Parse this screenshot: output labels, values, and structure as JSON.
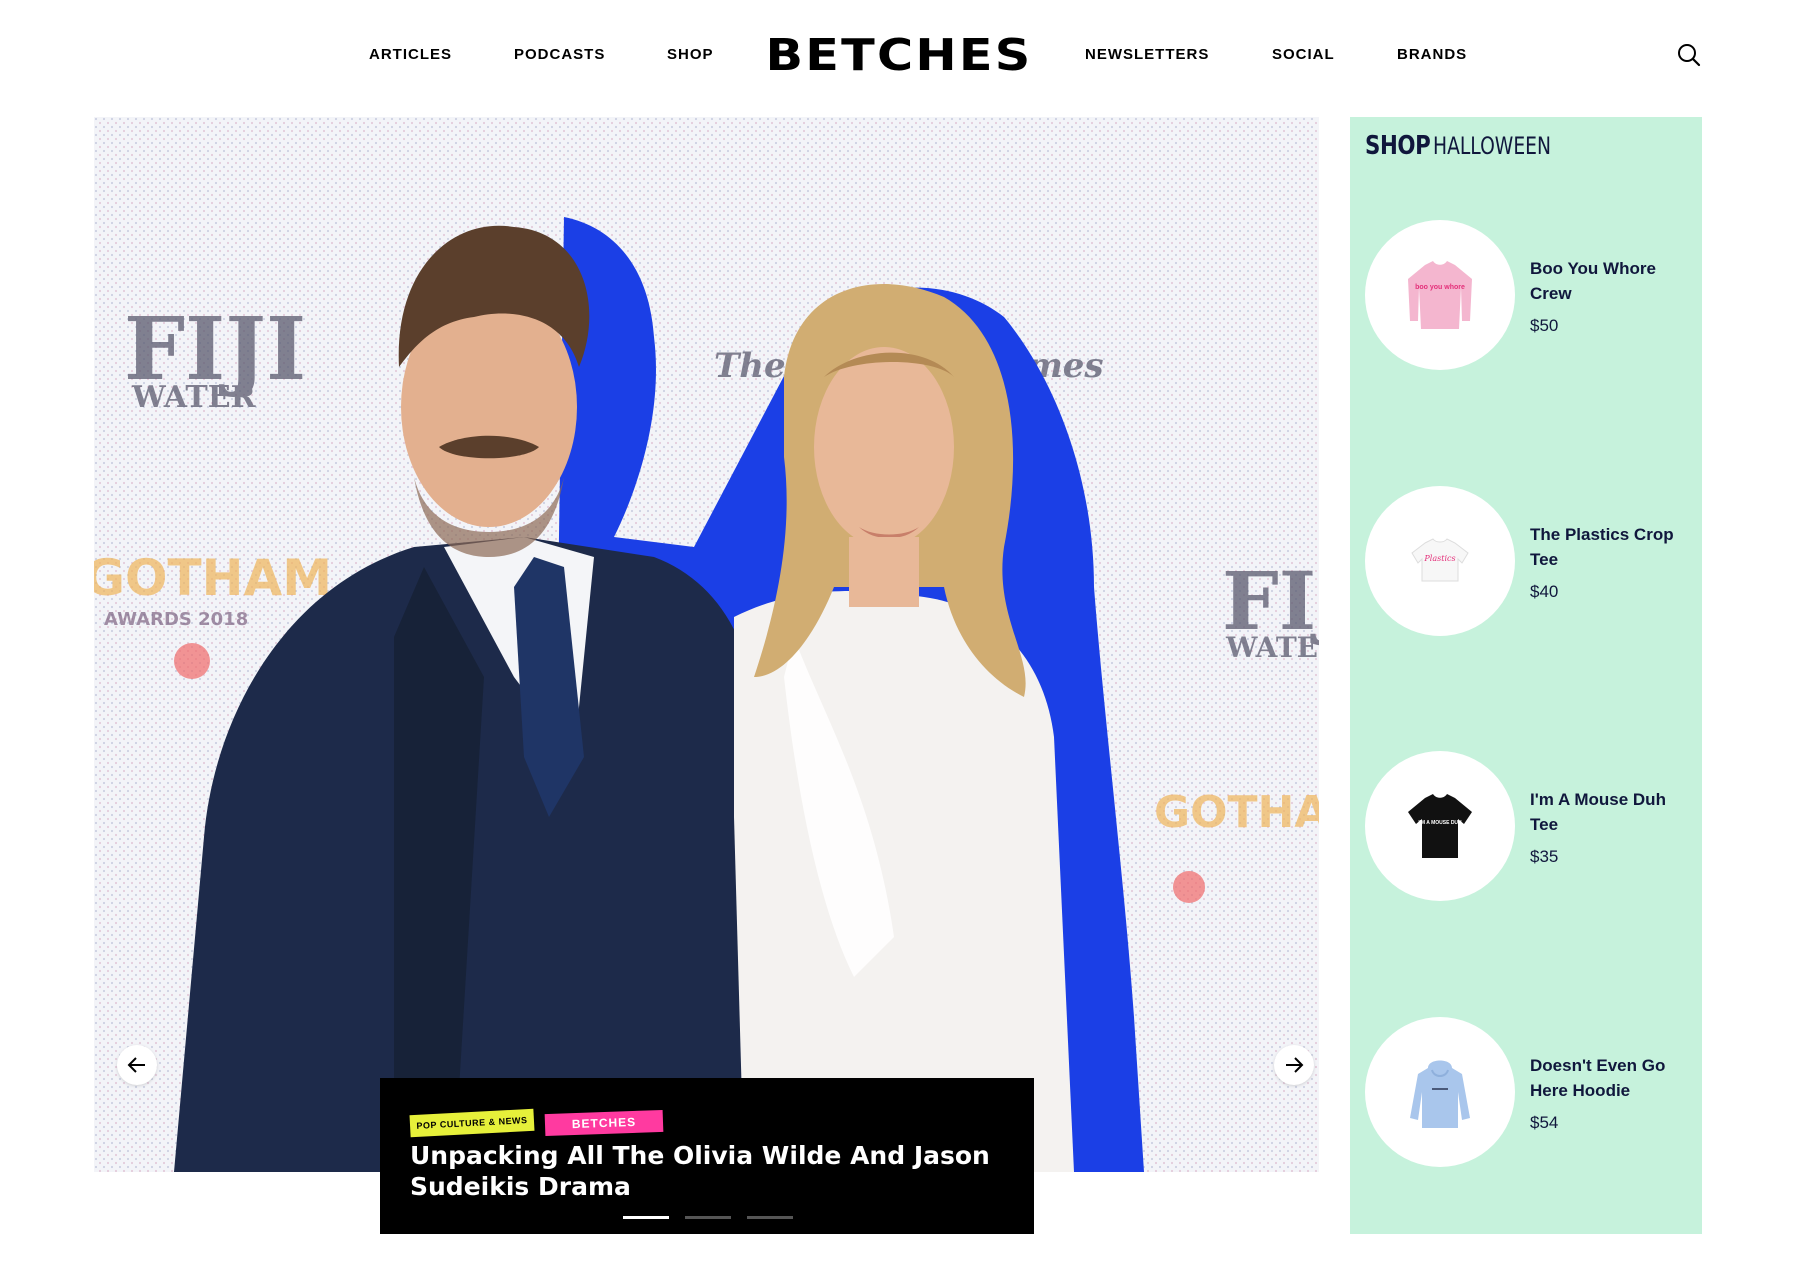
{
  "nav": {
    "left": [
      "ARTICLES",
      "PODCASTS",
      "SHOP"
    ],
    "brand": "BETCHES",
    "right": [
      "NEWSLETTERS",
      "SOCIAL",
      "BRANDS"
    ],
    "search_icon": "search-icon"
  },
  "hero": {
    "category_tag": "POP CULTURE & NEWS",
    "brand_tag": "BETCHES",
    "headline": "Unpacking All The Olivia Wilde And Jason Sudeikis Drama",
    "prev_icon": "arrow-left-icon",
    "next_icon": "arrow-right-icon",
    "slide_count": 3,
    "active_slide": 1,
    "backdrop_text": {
      "fiji": "FIJI",
      "water": "WATER",
      "nyt": "The New York Times",
      "gotham": "GOTHAM",
      "awards": "AWARDS 2018"
    },
    "colors": {
      "outline": "#1b3fe6",
      "suit": "#1d2a4a",
      "dress": "#f4f2f0",
      "hair": "#d1ad72",
      "skin": "#e8b898"
    }
  },
  "shop": {
    "title_bold": "SHOP",
    "title_light": "HALLOWEEN",
    "background": "#c6f2dc",
    "products": [
      {
        "name": "Boo You Whore Crew",
        "price": "$50",
        "icon": "sweatshirt-icon",
        "color": "#f4b6cf",
        "print": "boo you whore"
      },
      {
        "name": "The Plastics Crop Tee",
        "price": "$40",
        "icon": "crop-tee-icon",
        "color": "#ffffff",
        "print": "Plastics"
      },
      {
        "name": "I'm A Mouse Duh Tee",
        "price": "$35",
        "icon": "tshirt-icon",
        "color": "#111111",
        "print": "I'M A MOUSE DUH"
      },
      {
        "name": "Doesn't Even Go Here Hoodie",
        "price": "$54",
        "icon": "hoodie-icon",
        "color": "#a9c6ec",
        "print": ""
      }
    ]
  }
}
